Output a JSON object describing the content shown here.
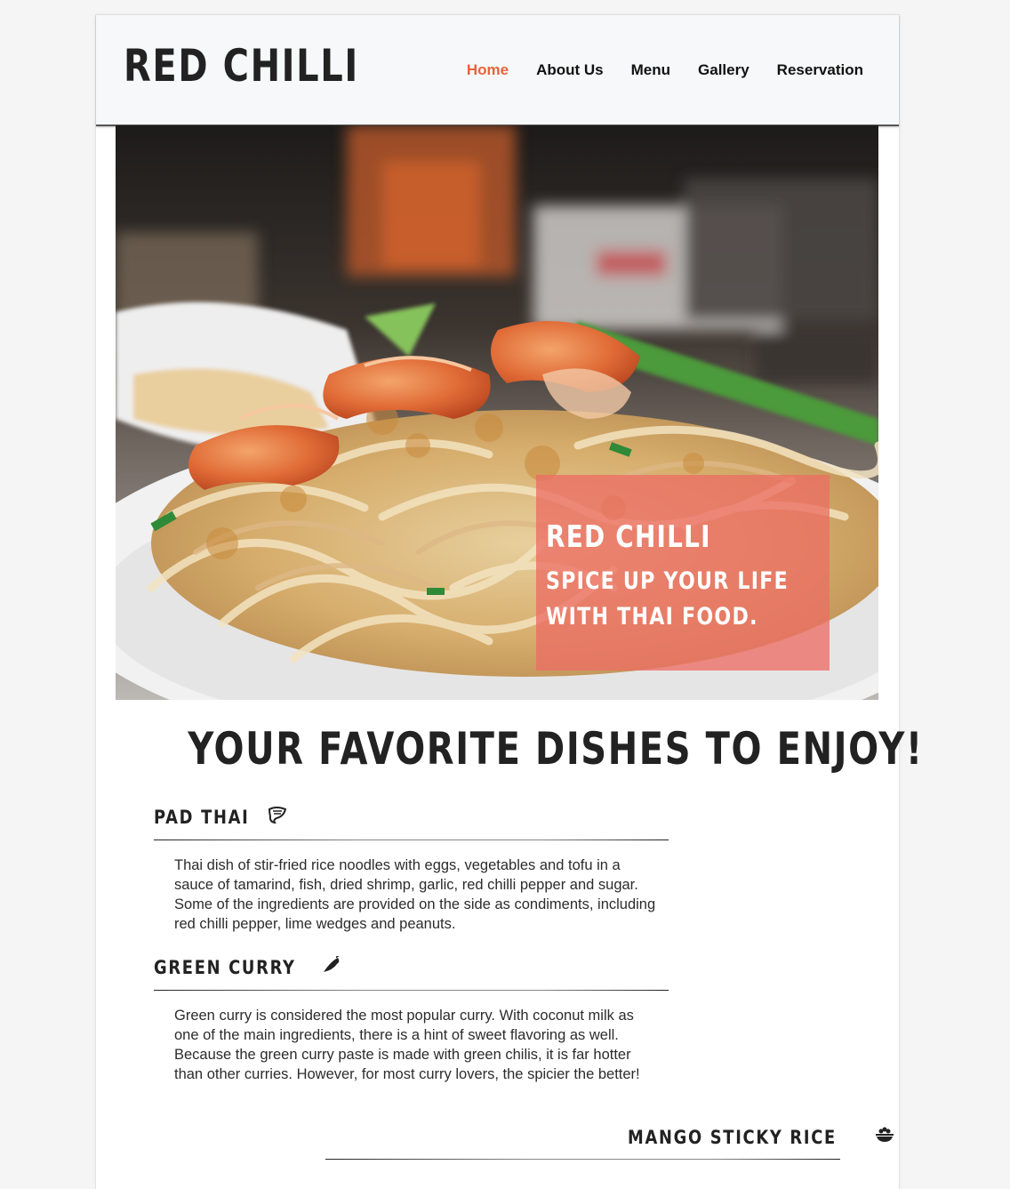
{
  "header": {
    "logo": "RED CHILLI",
    "nav": [
      {
        "label": "Home",
        "active": true
      },
      {
        "label": "About Us",
        "active": false
      },
      {
        "label": "Menu",
        "active": false
      },
      {
        "label": "Gallery",
        "active": false
      },
      {
        "label": "Reservation",
        "active": false
      }
    ]
  },
  "hero": {
    "title": "RED CHILLI",
    "subtitle_line1": "SPICE UP YOUR LIFE",
    "subtitle_line2": "WITH THAI FOOD."
  },
  "dishes_section": {
    "title": "YOUR FAVORITE DISHES TO ENJOY!",
    "dishes": [
      {
        "name": "PAD THAI",
        "icon": "shrimp-icon",
        "description": "Thai dish of stir-fried rice noodles with eggs, vegetables and tofu in a sauce of tamarind, fish, dried shrimp, garlic, red chilli pepper and sugar. Some of the ingredients are provided on the side as condiments, including red chilli pepper, lime wedges and peanuts."
      },
      {
        "name": "GREEN CURRY",
        "icon": "pepper-icon",
        "description": "Green curry is considered the most popular curry. With coconut milk as one of the main ingredients, there is a hint of sweet flavoring as well. Because the green curry paste is made with green chilis, it is far hotter than other curries. However, for most curry lovers, the spicier the better!"
      },
      {
        "name": "MANGO STICKY RICE",
        "icon": "rice-bowl-icon",
        "description": ""
      }
    ]
  },
  "colors": {
    "accent": "#e8623d",
    "caption_bg": "#ec6e64",
    "text": "#222222"
  }
}
